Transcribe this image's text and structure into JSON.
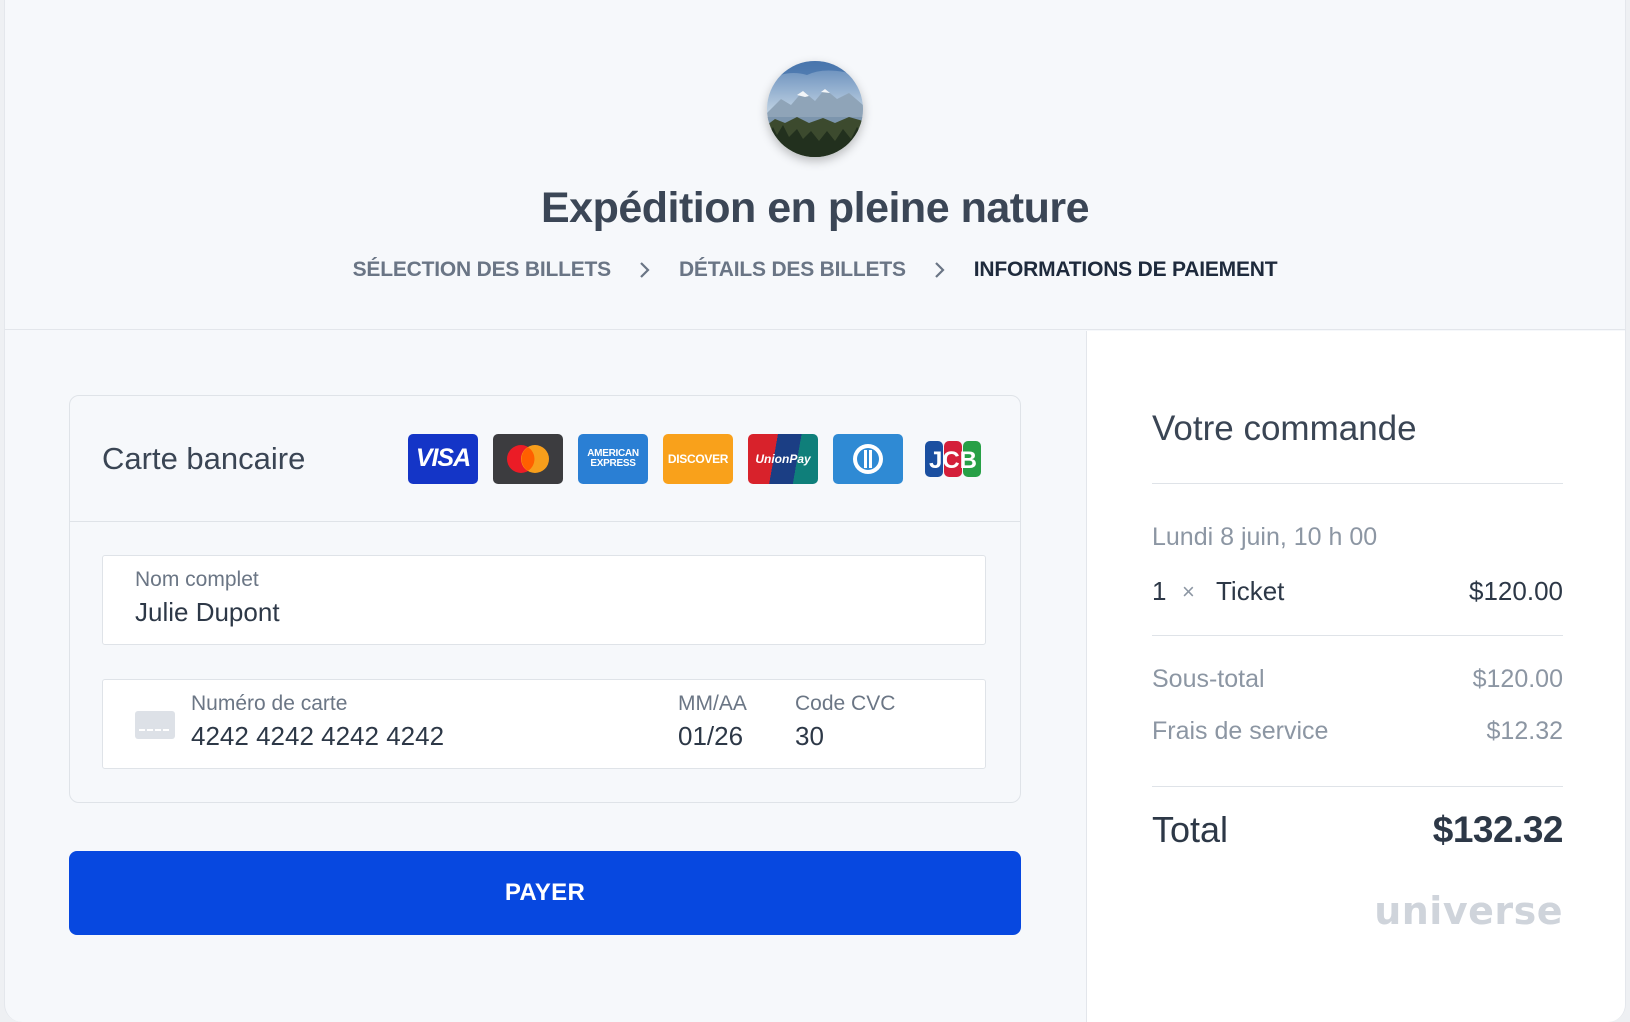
{
  "event": {
    "title": "Expédition en pleine nature",
    "avatar_icon": "mountain-landscape-photo"
  },
  "breadcrumb": {
    "step1": "SÉLECTION DES BILLETS",
    "step2": "DÉTAILS DES BILLETS",
    "step3": "INFORMATIONS DE PAIEMENT",
    "active_step": 3
  },
  "payment": {
    "title": "Carte bancaire",
    "brands": {
      "visa": "VISA",
      "mastercard_icon": "mastercard-logo",
      "amex_line1": "AMERICAN",
      "amex_line2": "EXPRESS",
      "discover": "DISCOVER",
      "unionpay": "UnionPay",
      "diners_icon": "diners-club-logo",
      "jcb": "JCB"
    },
    "name_field": {
      "label": "Nom complet",
      "value": "Julie Dupont"
    },
    "card_field": {
      "icon": "credit-card-icon",
      "number_label": "Numéro de carte",
      "number_value": "4242 4242 4242 4242",
      "expiry_label": "MM/AA",
      "expiry_value": "01/26",
      "cvc_label": "Code CVC",
      "cvc_value": "30"
    },
    "pay_button": "PAYER"
  },
  "order": {
    "title": "Votre commande",
    "date": "Lundi 8 juin, 10 h 00",
    "item": {
      "qty": "1",
      "times": "×",
      "name": "Ticket",
      "price": "$120.00"
    },
    "subtotal_label": "Sous-total",
    "subtotal_value": "$120.00",
    "fee_label": "Frais de service",
    "fee_value": "$12.32",
    "total_label": "Total",
    "total_value": "$132.32",
    "brand_logo": "universe"
  },
  "colors": {
    "primary": "#0748e0",
    "background": "#f6f8fb",
    "text": "#2e3a4b"
  }
}
